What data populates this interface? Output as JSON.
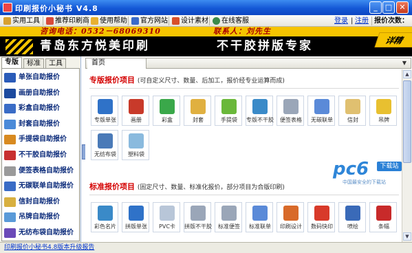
{
  "window": {
    "title": "印刷报价小秘书 V4.8"
  },
  "toolbar": {
    "items": [
      {
        "label": "实用工具",
        "icon": "tools-icon"
      },
      {
        "label": "推荐印刷商",
        "icon": "recommend-icon"
      },
      {
        "label": "使用帮助",
        "icon": "help-icon"
      },
      {
        "label": "官方网站",
        "icon": "website-icon"
      },
      {
        "label": "设计素材",
        "icon": "design-icon"
      },
      {
        "label": "在线客服",
        "icon": "service-icon"
      }
    ],
    "login": "登录",
    "separator": "|",
    "register": "注册",
    "quote_count_label": "报价次数："
  },
  "banner": {
    "phone": "咨询电话：0532－68069310",
    "contact": "联系人：刘先生",
    "company": "青岛东方悦美印刷",
    "slogan": "不干胶拼版专家",
    "detail": "详精"
  },
  "left_tabs": [
    "专版",
    "标准",
    "工具"
  ],
  "left_menu": [
    {
      "label": "单张自助报价",
      "icon": "sheet-icon",
      "color": "#2a5bb8"
    },
    {
      "label": "画册自助报价",
      "icon": "album-icon",
      "color": "#1c4a9e"
    },
    {
      "label": "彩盒自助报价",
      "icon": "colorbox-icon",
      "color": "#3a6cc6"
    },
    {
      "label": "封套自助报价",
      "icon": "envelope-icon",
      "color": "#4a8ad8"
    },
    {
      "label": "手提袋自助报价",
      "icon": "handbag-icon",
      "color": "#d88a20"
    },
    {
      "label": "不干胶自助报价",
      "icon": "sticker-icon",
      "color": "#c83030"
    },
    {
      "label": "便签表格自助报价",
      "icon": "notepad-icon",
      "color": "#9a9a9a"
    },
    {
      "label": "无碳联单自助报价",
      "icon": "carbonless-icon",
      "color": "#3a6cc6"
    },
    {
      "label": "信封自助报价",
      "icon": "letter-icon",
      "color": "#d8b040"
    },
    {
      "label": "吊牌自助报价",
      "icon": "tag-icon",
      "color": "#5a9ad8"
    },
    {
      "label": "无纺布袋自助报价",
      "icon": "nonwoven-icon",
      "color": "#6a4ab8"
    }
  ],
  "right_tab": {
    "label": "首页"
  },
  "section1": {
    "title": "专版报价项目",
    "note": "(可自定义尺寸、数量、后加工，报价经专业运算而成)",
    "items": [
      {
        "label": "专版单张",
        "icon": "globe-icon",
        "color": "#2f72c8"
      },
      {
        "label": "画册",
        "icon": "album-book-icon",
        "color": "#c83a2a"
      },
      {
        "label": "彩盒",
        "icon": "cubes-icon",
        "color": "#3aa84a"
      },
      {
        "label": "封套",
        "icon": "folder-icon",
        "color": "#e0b040"
      },
      {
        "label": "手提袋",
        "icon": "bag-icon",
        "color": "#6ab83a"
      },
      {
        "label": "专版不干胶",
        "icon": "label-icon",
        "color": "#3a8ac8"
      },
      {
        "label": "便签表格",
        "icon": "doc-icon",
        "color": "#9aa6b8"
      },
      {
        "label": "无碳联单",
        "icon": "forms-icon",
        "color": "#5a8ad8"
      },
      {
        "label": "信封",
        "icon": "mail-icon",
        "color": "#e0c070"
      },
      {
        "label": "吊牌",
        "icon": "hangtag-icon",
        "color": "#e8c030"
      },
      {
        "label": "无纺布袋",
        "icon": "cloth-bag-icon",
        "color": "#4a7ab8"
      },
      {
        "label": "塑料袋",
        "icon": "plastic-bag-icon",
        "color": "#8abade"
      }
    ]
  },
  "section2": {
    "title": "标准报价项目",
    "note": "(固定尺寸、数量、标准化报价，部分项目为合版印刷)",
    "items": [
      {
        "label": "彩色名片",
        "icon": "card-icon",
        "color": "#3a8ac8"
      },
      {
        "label": "拼版单张",
        "icon": "globe-icon",
        "color": "#2f72c8"
      },
      {
        "label": "PVC卡",
        "icon": "pvc-card-icon",
        "color": "#b8c6d8"
      },
      {
        "label": "拼版不干胶",
        "icon": "label-icon",
        "color": "#9aa6b8"
      },
      {
        "label": "标准便签",
        "icon": "doc-icon",
        "color": "#9aa6b8"
      },
      {
        "label": "标准联单",
        "icon": "forms-icon",
        "color": "#5a8ad8"
      },
      {
        "label": "印刷设计",
        "icon": "design-doc-icon",
        "color": "#d86a2a"
      },
      {
        "label": "数码快印",
        "icon": "printer-icon",
        "color": "#d83a2a"
      },
      {
        "label": "喷绘",
        "icon": "spray-icon",
        "color": "#3a6ab8"
      },
      {
        "label": "条幅",
        "icon": "banner-icon",
        "color": "#c82a2a"
      }
    ]
  },
  "watermark": {
    "logo": "pc6",
    "badge": "下载站",
    "sub": "中国最安全的下载站"
  },
  "status": {
    "link": "印刷报价小秘书4.8版本升级报告"
  }
}
